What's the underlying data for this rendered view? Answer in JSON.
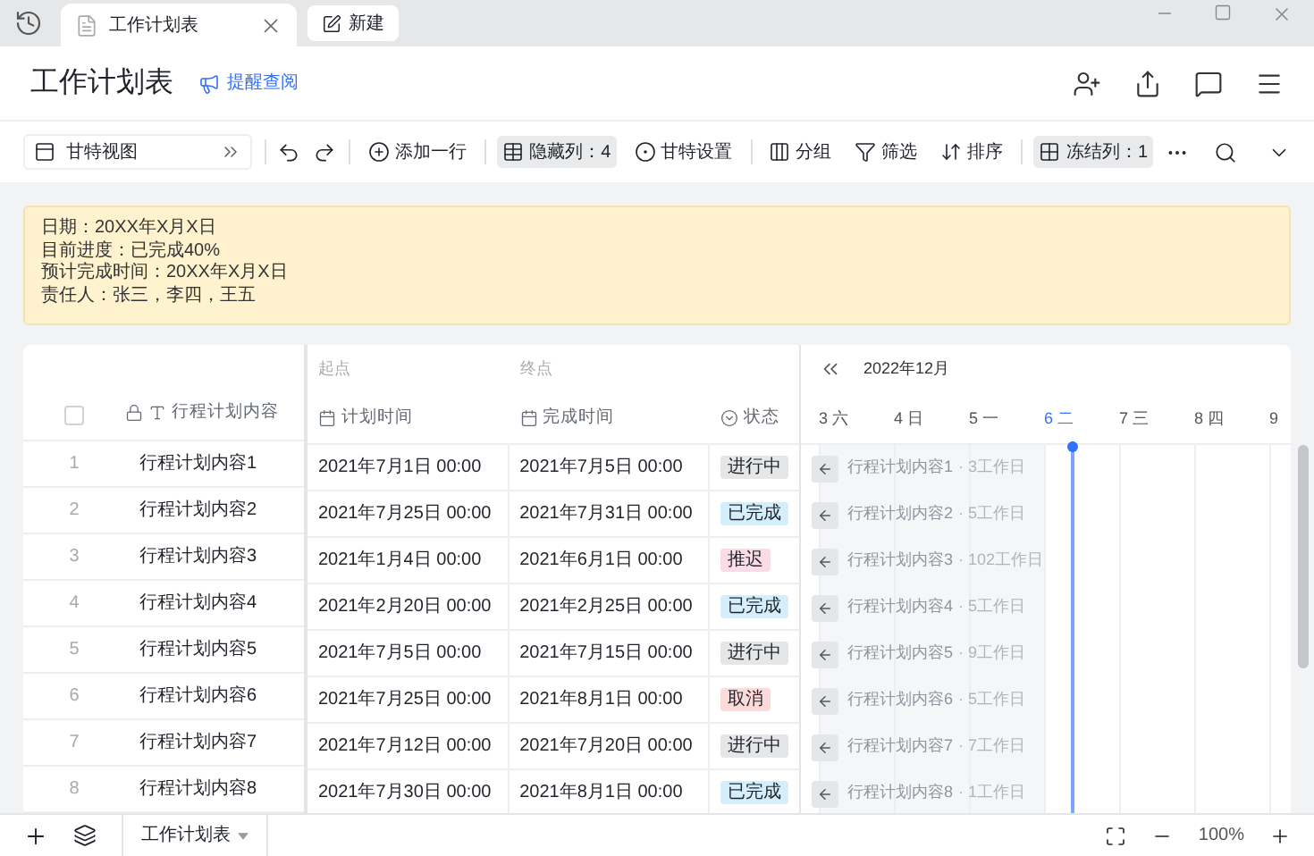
{
  "tabs": [
    {
      "label": "工作计划表",
      "selected": true,
      "kind": "doc"
    },
    {
      "label": "新建",
      "selected": false,
      "kind": "new"
    }
  ],
  "header": {
    "title": "工作计划表",
    "remind": "提醒查阅"
  },
  "toolbar": {
    "view": "甘特视图",
    "items": [
      {
        "kind": "add",
        "label": "添加一行",
        "highlighted": false
      },
      {
        "kind": "hide",
        "label": "隐藏列：4",
        "highlighted": true
      },
      {
        "kind": "gantt",
        "label": "甘特设置",
        "highlighted": false
      },
      {
        "kind": "group",
        "label": "分组",
        "highlighted": false
      },
      {
        "kind": "filter",
        "label": "筛选",
        "highlighted": false
      },
      {
        "kind": "sort",
        "label": "排序",
        "highlighted": false
      },
      {
        "kind": "freeze",
        "label": "冻结列：1",
        "highlighted": true
      }
    ]
  },
  "notice": [
    "日期：20XX年X月X日",
    "目前进度：已完成40%",
    "预计完成时间：20XX年X月X日",
    "责任人：张三，李四，王五"
  ],
  "table": {
    "select_all": {
      "checked": false
    },
    "group_labels": [
      "起点",
      "终点"
    ],
    "columns": [
      {
        "kind": "text",
        "label": "行程计划内容"
      },
      {
        "kind": "date",
        "label": "计划时间"
      },
      {
        "kind": "date",
        "label": "完成时间"
      },
      {
        "kind": "select",
        "label": "状态"
      }
    ],
    "rows": [
      {
        "index": "1",
        "name": "行程计划内容1",
        "start": "2021年7月1日 00:00",
        "end": "2021年7月5日 00:00",
        "status": {
          "text": "进行中",
          "color": "#e5e6e8"
        }
      },
      {
        "index": "2",
        "name": "行程计划内容2",
        "start": "2021年7月25日 00:00",
        "end": "2021年7月31日 00:00",
        "status": {
          "text": "已完成",
          "color": "#d4eefc"
        }
      },
      {
        "index": "3",
        "name": "行程计划内容3",
        "start": "2021年1月4日 00:00",
        "end": "2021年6月1日 00:00",
        "status": {
          "text": "推迟",
          "color": "#fbdbe5"
        }
      },
      {
        "index": "4",
        "name": "行程计划内容4",
        "start": "2021年2月20日 00:00",
        "end": "2021年2月25日 00:00",
        "status": {
          "text": "已完成",
          "color": "#d4eefc"
        }
      },
      {
        "index": "5",
        "name": "行程计划内容5",
        "start": "2021年7月5日 00:00",
        "end": "2021年7月15日 00:00",
        "status": {
          "text": "进行中",
          "color": "#e5e6e8"
        }
      },
      {
        "index": "6",
        "name": "行程计划内容6",
        "start": "2021年7月25日 00:00",
        "end": "2021年8月1日 00:00",
        "status": {
          "text": "取消",
          "color": "#fcdada"
        }
      },
      {
        "index": "7",
        "name": "行程计划内容7",
        "start": "2021年7月12日 00:00",
        "end": "2021年7月20日 00:00",
        "status": {
          "text": "进行中",
          "color": "#e5e6e8"
        }
      },
      {
        "index": "8",
        "name": "行程计划内容8",
        "start": "2021年7月30日 00:00",
        "end": "2021年8月1日 00:00",
        "status": {
          "text": "已完成",
          "color": "#d4eefc"
        }
      }
    ]
  },
  "gantt": {
    "month": "2022年12月",
    "days": [
      {
        "label": "3 六",
        "today": false
      },
      {
        "label": "4 日",
        "today": false
      },
      {
        "label": "5 一",
        "today": false
      },
      {
        "label": "6 二",
        "today": true
      },
      {
        "label": "7 三",
        "today": false
      },
      {
        "label": "8 四",
        "today": false
      },
      {
        "label": "9",
        "today": false
      }
    ],
    "bars": [
      {
        "name": "行程计划内容1",
        "duration": "· 3工作日"
      },
      {
        "name": "行程计划内容2",
        "duration": "· 5工作日"
      },
      {
        "name": "行程计划内容3",
        "duration": "· 102工作日"
      },
      {
        "name": "行程计划内容4",
        "duration": "· 5工作日"
      },
      {
        "name": "行程计划内容5",
        "duration": "· 9工作日"
      },
      {
        "name": "行程计划内容6",
        "duration": "· 5工作日"
      },
      {
        "name": "行程计划内容7",
        "duration": "· 7工作日"
      },
      {
        "name": "行程计划内容8",
        "duration": "· 1工作日"
      }
    ]
  },
  "bottom": {
    "sheet": "工作计划表",
    "zoom": "100%"
  }
}
